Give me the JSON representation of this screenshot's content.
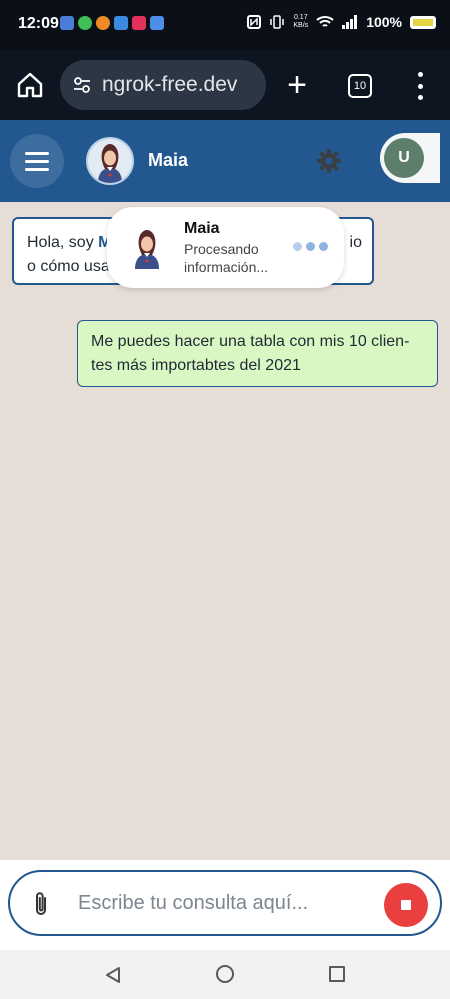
{
  "status_bar": {
    "time": "12:09",
    "net_speed_value": "0.17",
    "net_speed_unit": "KB/s",
    "battery": "100%"
  },
  "browser": {
    "url": "ngrok-free.dev",
    "tab_count": "10"
  },
  "header": {
    "bot_name": "Maia",
    "user_initial": "U"
  },
  "chat": {
    "bot_message_line1_prefix": "Hola, soy ",
    "bot_message_line1_highlight": "M",
    "bot_message_line1_end": "io",
    "bot_message_line2": "o cómo usa",
    "user_message": "Me puedes hacer una tabla con mis 10 clien-tes más importabtes del 2021"
  },
  "toast": {
    "name": "Maia",
    "status": "Procesando información..."
  },
  "input": {
    "placeholder": "Escribe tu consulta aquí..."
  },
  "colors": {
    "header_bg": "#22578f",
    "user_bubble_bg": "#d9f7c2",
    "stop_button": "#e9403f",
    "chat_bg": "#e6ddd7"
  }
}
